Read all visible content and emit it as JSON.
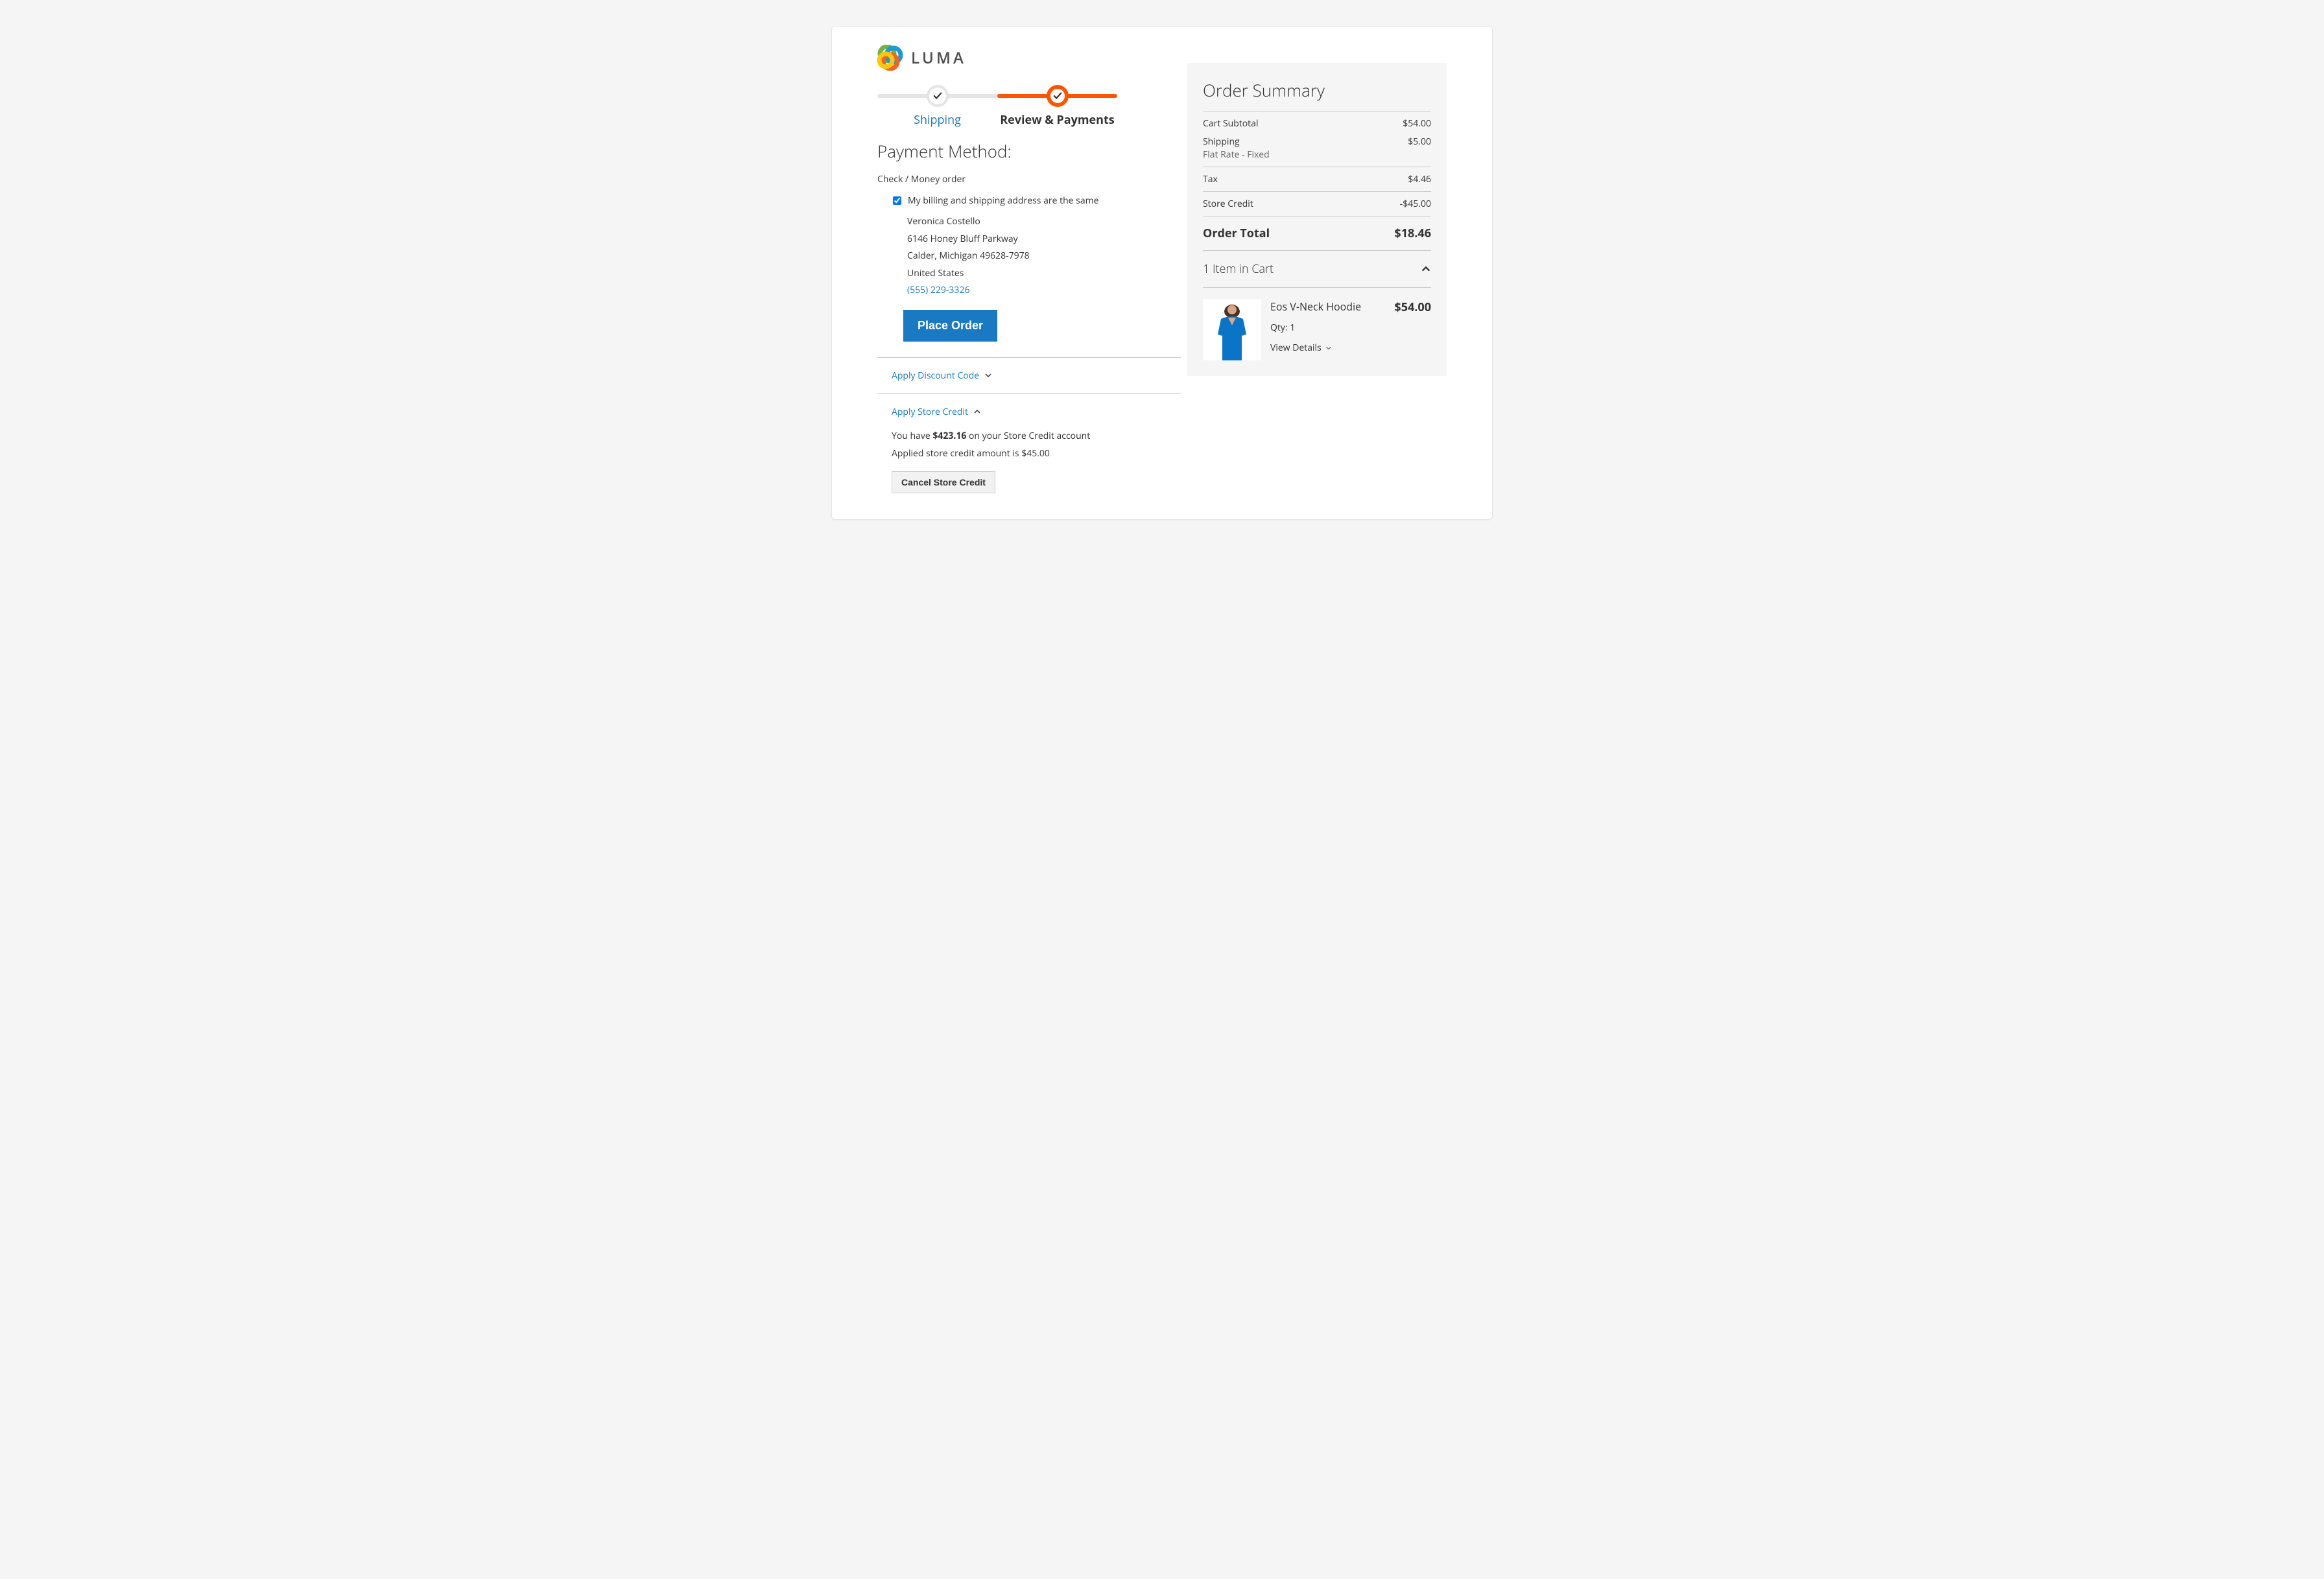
{
  "brand": "LUMA",
  "progress": {
    "shipping": "Shipping",
    "review": "Review & Payments"
  },
  "section_title": "Payment Method:",
  "method_name": "Check / Money order",
  "same_address_label": "My billing and shipping address are the same",
  "address": {
    "name": "Veronica Costello",
    "street": "6146 Honey Bluff Parkway",
    "city_line": "Calder, Michigan 49628-7978",
    "country": "United States",
    "phone": "(555) 229-3326"
  },
  "place_order": "Place Order",
  "discount_toggle": "Apply Discount Code",
  "credit_toggle": "Apply Store Credit",
  "credit_balance_prefix": "You have ",
  "credit_balance_amount": "$423.16",
  "credit_balance_suffix": " on your Store Credit account",
  "credit_applied": "Applied store credit amount is $45.00",
  "cancel_credit": "Cancel Store Credit",
  "summary": {
    "title": "Order Summary",
    "rows": [
      {
        "label": "Cart Subtotal",
        "value": "$54.00"
      },
      {
        "label": "Shipping",
        "sub": "Flat Rate - Fixed",
        "value": "$5.00"
      },
      {
        "label": "Tax",
        "value": "$4.46"
      },
      {
        "label": "Store Credit",
        "value": "-$45.00"
      }
    ],
    "total_label": "Order Total",
    "total_value": "$18.46"
  },
  "cart": {
    "heading": "1 Item in Cart",
    "item": {
      "name": "Eos V-Neck Hoodie",
      "price": "$54.00",
      "qty": "Qty: 1",
      "details": "View Details"
    }
  }
}
